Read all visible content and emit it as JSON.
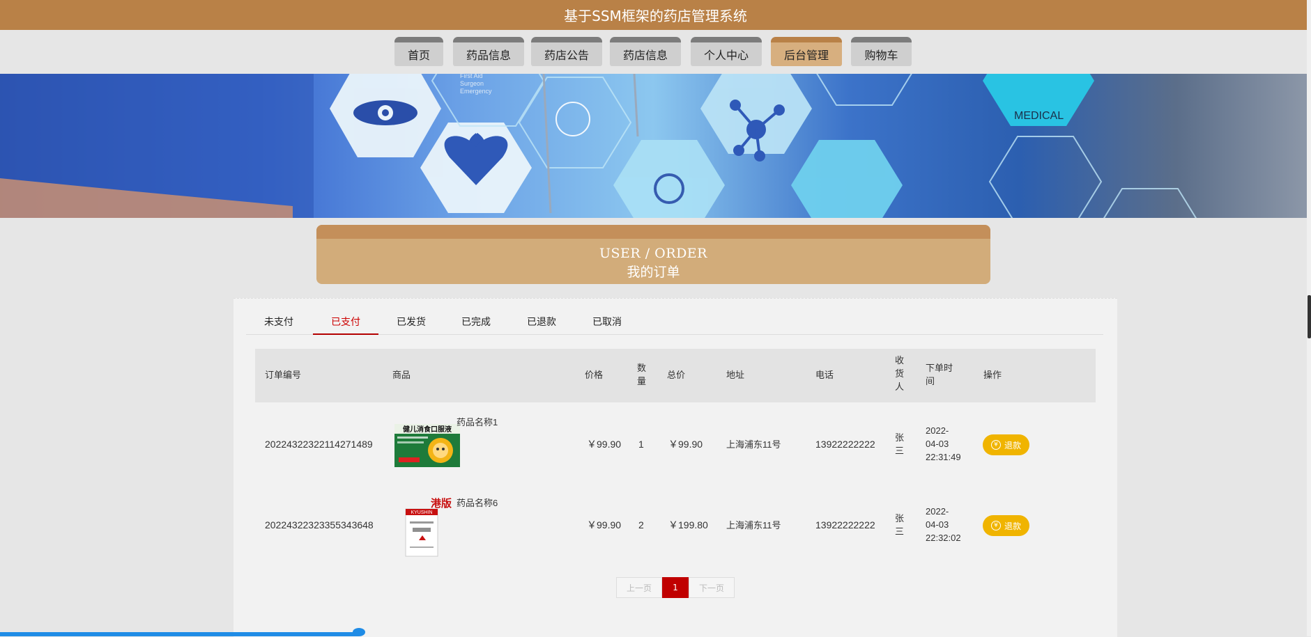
{
  "app": {
    "title": "基于SSM框架的药店管理系统"
  },
  "nav": {
    "items": [
      {
        "label": "首页",
        "active": false
      },
      {
        "label": "药品信息",
        "active": false
      },
      {
        "label": "药店公告",
        "active": false
      },
      {
        "label": "药店信息",
        "active": false
      },
      {
        "label": "个人中心",
        "active": false
      },
      {
        "label": "后台管理",
        "active": true
      },
      {
        "label": "购物车",
        "active": false
      }
    ]
  },
  "banner": {
    "medical_text": "MEDICAL",
    "first_aid_lines": [
      "First Aid",
      "Surgeon",
      "Emergency"
    ]
  },
  "section": {
    "title_en": "USER / ORDER",
    "title_zh": "我的订单"
  },
  "tabs": [
    {
      "label": "未支付",
      "active": false
    },
    {
      "label": "已支付",
      "active": true
    },
    {
      "label": "已发货",
      "active": false
    },
    {
      "label": "已完成",
      "active": false
    },
    {
      "label": "已退款",
      "active": false
    },
    {
      "label": "已取消",
      "active": false
    }
  ],
  "table": {
    "headers": {
      "order_no": "订单编号",
      "product": "商品",
      "price": "价格",
      "qty": [
        "数",
        "量"
      ],
      "total": "总价",
      "address": "地址",
      "phone": "电话",
      "receiver": [
        "收",
        "货",
        "人"
      ],
      "time": [
        "下单时",
        "间"
      ],
      "action": "操作"
    },
    "rows": [
      {
        "order_no": "20224322322114271489",
        "product_name": "药品名称1",
        "product_image_text": "健儿消食口服液",
        "price": "￥99.90",
        "qty": "1",
        "total": "￥99.90",
        "address": "上海浦东11号",
        "phone": "13922222222",
        "receiver": [
          "张",
          "三"
        ],
        "time": [
          "2022-",
          "04-03",
          "22:31:49"
        ],
        "action": "退款"
      },
      {
        "order_no": "20224322323355343648",
        "product_name": "药品名称6",
        "product_image_text": "港版",
        "product_image_sub": "KYUSHIN",
        "price": "￥99.90",
        "qty": "2",
        "total": "￥199.80",
        "address": "上海浦东11号",
        "phone": "13922222222",
        "receiver": [
          "张",
          "三"
        ],
        "time": [
          "2022-",
          "04-03",
          "22:32:02"
        ],
        "action": "退款"
      }
    ]
  },
  "pagination": {
    "prev": "上一页",
    "current": "1",
    "next": "下一页"
  },
  "colors": {
    "brand": "#b98147",
    "accent_red": "#c00000",
    "refund_yellow": "#f0b400"
  },
  "icons": {
    "refund": "yen-coin-icon"
  }
}
